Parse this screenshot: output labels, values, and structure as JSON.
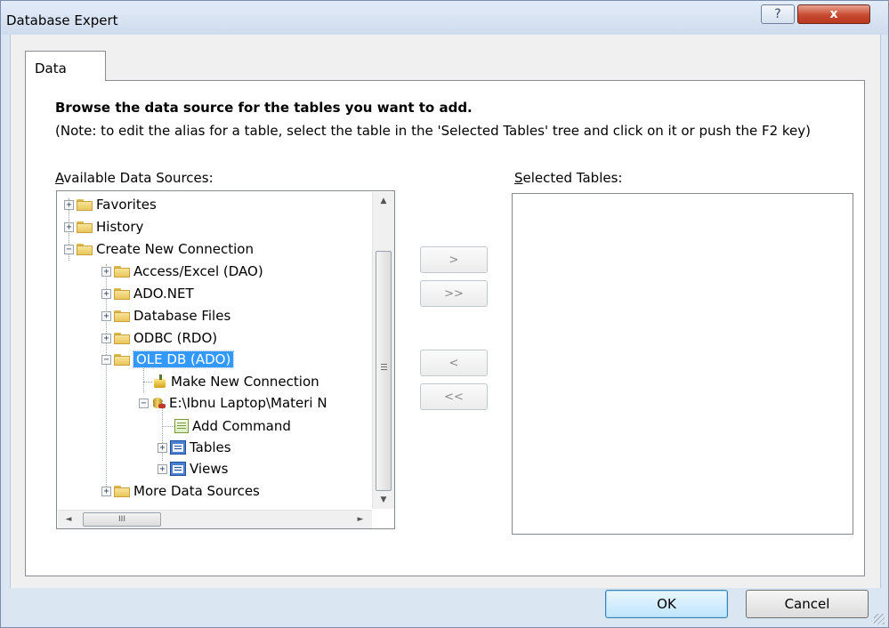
{
  "window": {
    "title": "Database Expert",
    "help_glyph": "?",
    "close_glyph": "x"
  },
  "tab": {
    "label": "Data"
  },
  "instructions": {
    "heading": "Browse the data source for the tables you want to add.",
    "note": "(Note: to edit the alias for a table, select the table in the 'Selected Tables' tree and click on it or push the F2 key)"
  },
  "available": {
    "label_key": "A",
    "label_rest": "vailable Data Sources:",
    "tree": [
      {
        "label": "Favorites",
        "icon": "folder-icon",
        "expander": "+"
      },
      {
        "label": "History",
        "icon": "folder-icon",
        "expander": "+"
      },
      {
        "label": "Create New Connection",
        "icon": "folder-icon",
        "expander": "−"
      },
      {
        "label": "Access/Excel (DAO)",
        "icon": "folder-icon",
        "expander": "+"
      },
      {
        "label": "ADO.NET",
        "icon": "folder-icon",
        "expander": "+"
      },
      {
        "label": "Database Files",
        "icon": "folder-icon",
        "expander": "+"
      },
      {
        "label": "ODBC (RDO)",
        "icon": "folder-icon",
        "expander": "+"
      },
      {
        "label": "OLE DB (ADO)",
        "icon": "folder-icon",
        "expander": "−",
        "selected": true
      },
      {
        "label": "Make New Connection",
        "icon": "wand-icon"
      },
      {
        "label": "E:\\Ibnu Laptop\\Materi N",
        "icon": "database-icon",
        "expander": "−"
      },
      {
        "label": "Add Command",
        "icon": "command-icon"
      },
      {
        "label": "Tables",
        "icon": "table-icon",
        "expander": "+"
      },
      {
        "label": "Views",
        "icon": "table-icon",
        "expander": "+"
      },
      {
        "label": "More Data Sources",
        "icon": "folder-icon",
        "expander": "+"
      }
    ],
    "scroll_up_glyph": "▲",
    "scroll_down_glyph": "▼",
    "scroll_left_glyph": "◄",
    "scroll_right_glyph": "►",
    "hthumb_grip": "III"
  },
  "selected_tables": {
    "label_key": "S",
    "label_rest": "elected Tables:"
  },
  "move_buttons": {
    "add": ">",
    "add_all": ">>",
    "remove": "<",
    "remove_all": "<<"
  },
  "dialog_buttons": {
    "ok": "OK",
    "cancel": "Cancel"
  }
}
